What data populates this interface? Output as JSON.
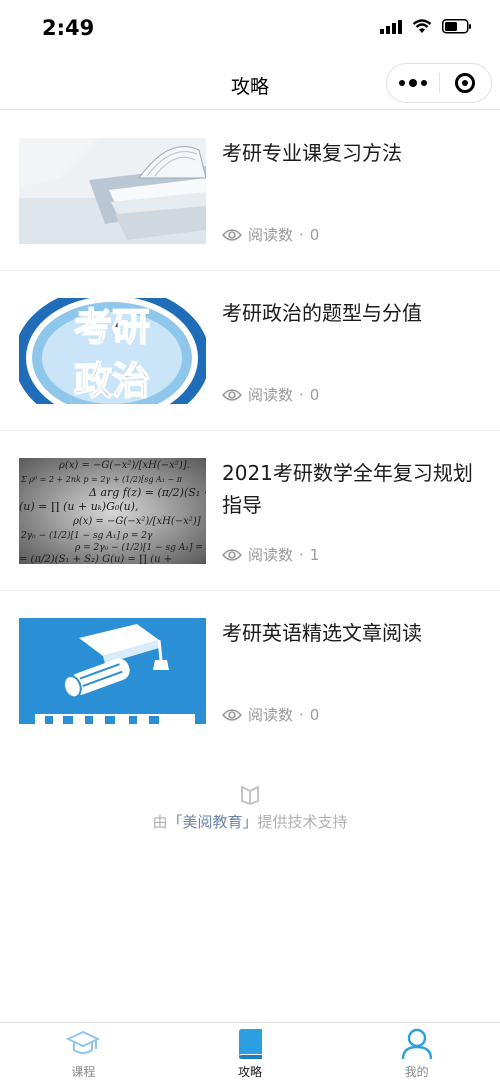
{
  "status_bar": {
    "time": "2:49"
  },
  "nav": {
    "title": "攻略"
  },
  "articles": [
    {
      "title": "考研专业课复习方法",
      "reads_label": "阅读数",
      "reads": "0",
      "thumb": "open-book"
    },
    {
      "title": "考研政治的题型与分值",
      "reads_label": "阅读数",
      "reads": "0",
      "thumb": "politics-badge",
      "thumb_text": "考研政治"
    },
    {
      "title": "2021考研数学全年复习规划指导",
      "reads_label": "阅读数",
      "reads": "1",
      "thumb": "math-formulas"
    },
    {
      "title": "考研英语精选文章阅读",
      "reads_label": "阅读数",
      "reads": "0",
      "thumb": "graduation-cap"
    }
  ],
  "support": {
    "prefix": "由",
    "brand": "「美阅教育」",
    "suffix": "提供技术支持"
  },
  "tabs": [
    {
      "label": "课程",
      "icon": "graduation-cap-icon",
      "active": false
    },
    {
      "label": "攻略",
      "icon": "book-icon",
      "active": true
    },
    {
      "label": "我的",
      "icon": "user-icon",
      "active": false
    }
  ],
  "colors": {
    "accent": "#2c9fe2",
    "tab_inactive": "#8ec8ef",
    "meta": "#9a9a9a"
  }
}
